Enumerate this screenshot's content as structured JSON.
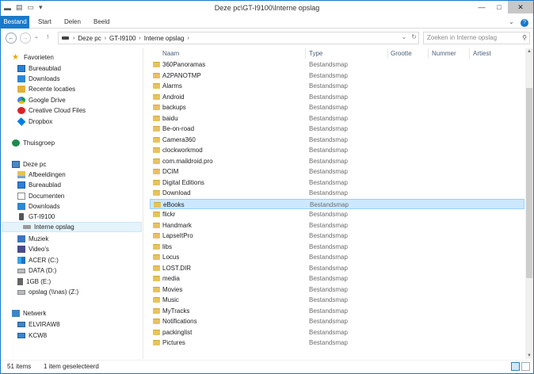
{
  "window": {
    "title": "Deze pc\\GT-I9100\\Interne opslag",
    "minimize": "—",
    "maximize": "□",
    "close": "✕"
  },
  "ribbon": {
    "tabs": [
      "Bestand",
      "Start",
      "Delen",
      "Beeld"
    ],
    "expand": "⌄",
    "help": "?"
  },
  "address": {
    "crumbs": [
      "Deze pc",
      "GT-I9100",
      "Interne opslag"
    ],
    "search_placeholder": "Zoeken in Interne opslag"
  },
  "nav": {
    "favorites": {
      "label": "Favorieten",
      "items": [
        "Bureaublad",
        "Downloads",
        "Recente locaties",
        "Google Drive",
        "Creative Cloud Files",
        "Dropbox"
      ]
    },
    "homegroup": "Thuisgroep",
    "this_pc": {
      "label": "Deze pc",
      "items": [
        "Afbeeldingen",
        "Bureaublad",
        "Documenten",
        "Downloads",
        "GT-I9100",
        "Interne opslag",
        "Muziek",
        "Video's",
        "ACER (C:)",
        "DATA (D:)",
        "1GB (E:)",
        "opslag (\\\\nas) (Z:)"
      ]
    },
    "network": {
      "label": "Netwerk",
      "items": [
        "ELVIRAW8",
        "KCW8"
      ]
    }
  },
  "columns": [
    "Naam",
    "Type",
    "Grootte",
    "Nummer",
    "Artiest"
  ],
  "files": [
    {
      "name": "360Panoramas",
      "type": "Bestandsmap"
    },
    {
      "name": "A2PANOTMP",
      "type": "Bestandsmap"
    },
    {
      "name": "Alarms",
      "type": "Bestandsmap"
    },
    {
      "name": "Android",
      "type": "Bestandsmap"
    },
    {
      "name": "backups",
      "type": "Bestandsmap"
    },
    {
      "name": "baidu",
      "type": "Bestandsmap"
    },
    {
      "name": "Be-on-road",
      "type": "Bestandsmap"
    },
    {
      "name": "Camera360",
      "type": "Bestandsmap"
    },
    {
      "name": "clockworkmod",
      "type": "Bestandsmap"
    },
    {
      "name": "com.maildroid.pro",
      "type": "Bestandsmap"
    },
    {
      "name": "DCIM",
      "type": "Bestandsmap"
    },
    {
      "name": "Digital Editions",
      "type": "Bestandsmap"
    },
    {
      "name": "Download",
      "type": "Bestandsmap"
    },
    {
      "name": "eBooks",
      "type": "Bestandsmap"
    },
    {
      "name": "flickr",
      "type": "Bestandsmap"
    },
    {
      "name": "Handmark",
      "type": "Bestandsmap"
    },
    {
      "name": "LapseItPro",
      "type": "Bestandsmap"
    },
    {
      "name": "libs",
      "type": "Bestandsmap"
    },
    {
      "name": "Locus",
      "type": "Bestandsmap"
    },
    {
      "name": "LOST.DIR",
      "type": "Bestandsmap"
    },
    {
      "name": "media",
      "type": "Bestandsmap"
    },
    {
      "name": "Movies",
      "type": "Bestandsmap"
    },
    {
      "name": "Music",
      "type": "Bestandsmap"
    },
    {
      "name": "MyTracks",
      "type": "Bestandsmap"
    },
    {
      "name": "Notifications",
      "type": "Bestandsmap"
    },
    {
      "name": "packinglist",
      "type": "Bestandsmap"
    },
    {
      "name": "Pictures",
      "type": "Bestandsmap"
    }
  ],
  "selected_file": "eBooks",
  "status": {
    "count": "51 items",
    "selection": "1 item geselecteerd"
  },
  "colors": {
    "accent": "#1979ca",
    "selection": "#cce8ff",
    "folder": "#e8c35d"
  }
}
